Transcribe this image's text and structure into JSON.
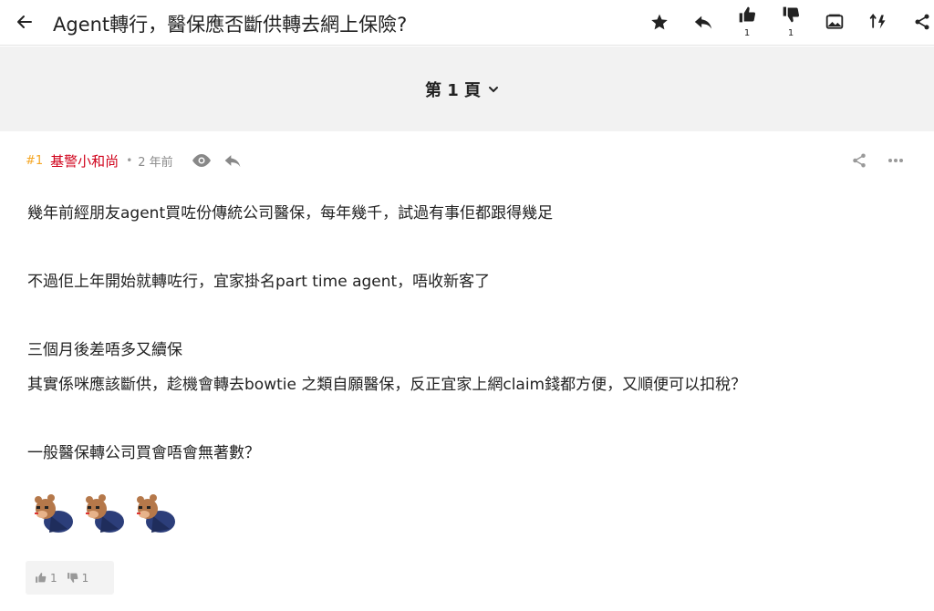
{
  "topbar": {
    "back_icon": "arrow-left-icon",
    "title": "Agent轉行，醫保應否斷供轉去網上保險?",
    "actions": [
      {
        "icon": "star-icon"
      },
      {
        "icon": "reply-icon"
      },
      {
        "icon": "thumbs-up-icon",
        "count": "1"
      },
      {
        "icon": "thumbs-down-icon",
        "count": "1"
      },
      {
        "icon": "image-icon"
      },
      {
        "icon": "sort-lightning-icon"
      },
      {
        "icon": "share-icon"
      }
    ]
  },
  "pagination": {
    "label": "第 1 頁",
    "icon": "chevron-down-icon"
  },
  "post": {
    "number": "#1",
    "author": "基警小和尚",
    "separator": "•",
    "time": "2 年前",
    "header_icons": [
      "eye-icon",
      "reply-icon"
    ],
    "tool_icons": [
      "share-icon",
      "more-horizontal-icon"
    ],
    "lines": [
      "幾年前經朋友agent買咗份傳統公司醫保，每年幾千，試過有事佢都跟得幾足",
      "",
      "不過佢上年開始就轉咗行，宜家掛名part time agent，唔收新客了",
      "",
      "三個月後差唔多又續保",
      "其實係咪應該斷供，趁機會轉去bowtie 之類自願醫保，反正宜家上網claim錢都方便，又順便可以扣稅？",
      "",
      "一般醫保轉公司買會唔會無著數？"
    ],
    "emojis": [
      "bowing-monkey-icon",
      "bowing-monkey-icon",
      "bowing-monkey-icon"
    ],
    "likes": "1",
    "dislikes": "1"
  },
  "colors": {
    "author": "#d0021b",
    "post_number": "#f5a623",
    "page_bar": "#f2f2f2",
    "text": "#222222",
    "muted": "#8a8a8a"
  }
}
